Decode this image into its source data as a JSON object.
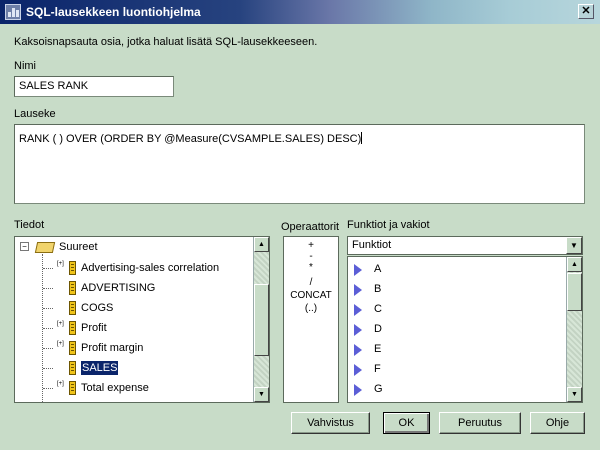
{
  "window": {
    "title": "SQL-lausekkeen luontiohjelma",
    "close_glyph": "✕"
  },
  "instructions": "Kaksoisnapsauta osia, jotka haluat lisätä SQL-lausekkeeseen.",
  "name": {
    "label": "Nimi",
    "value": "SALES RANK"
  },
  "expression": {
    "label": "Lauseke",
    "value": "RANK ( ) OVER (ORDER BY  @Measure(CVSAMPLE.SALES) DESC)"
  },
  "data_panel": {
    "label": "Tiedot",
    "root": {
      "label": "Suureet",
      "expander": "−",
      "icon": "folder-icon"
    },
    "items": [
      {
        "label": "Advertising-sales correlation",
        "expandable": true,
        "selected": false,
        "icon": "measure-icon"
      },
      {
        "label": "ADVERTISING",
        "expandable": false,
        "selected": false,
        "icon": "measure-icon"
      },
      {
        "label": "COGS",
        "expandable": false,
        "selected": false,
        "icon": "measure-icon"
      },
      {
        "label": "Profit",
        "expandable": true,
        "selected": false,
        "icon": "measure-icon"
      },
      {
        "label": "Profit margin",
        "expandable": true,
        "selected": false,
        "icon": "measure-icon"
      },
      {
        "label": "SALES",
        "expandable": false,
        "selected": true,
        "icon": "measure-icon"
      },
      {
        "label": "Total expense",
        "expandable": true,
        "selected": false,
        "icon": "measure-icon"
      }
    ],
    "expander_glyph": "[+]"
  },
  "operators": {
    "label": "Operaattorit",
    "items": [
      "+",
      "-",
      "*",
      "/",
      "CONCAT",
      "(..)"
    ]
  },
  "functions": {
    "label": "Funktiot ja vakiot",
    "selected": "Funktiot",
    "items": [
      "A",
      "B",
      "C",
      "D",
      "E",
      "F",
      "G"
    ],
    "item_icon": "triangle-right-icon"
  },
  "scroll": {
    "up_glyph": "▲",
    "down_glyph": "▼"
  },
  "buttons": {
    "validate": "Vahvistus",
    "ok": "OK",
    "cancel": "Peruutus",
    "help": "Ohje"
  },
  "colors": {
    "background": "#c8dcc8",
    "selection": "#0a246a",
    "title_start": "#0a246a"
  }
}
